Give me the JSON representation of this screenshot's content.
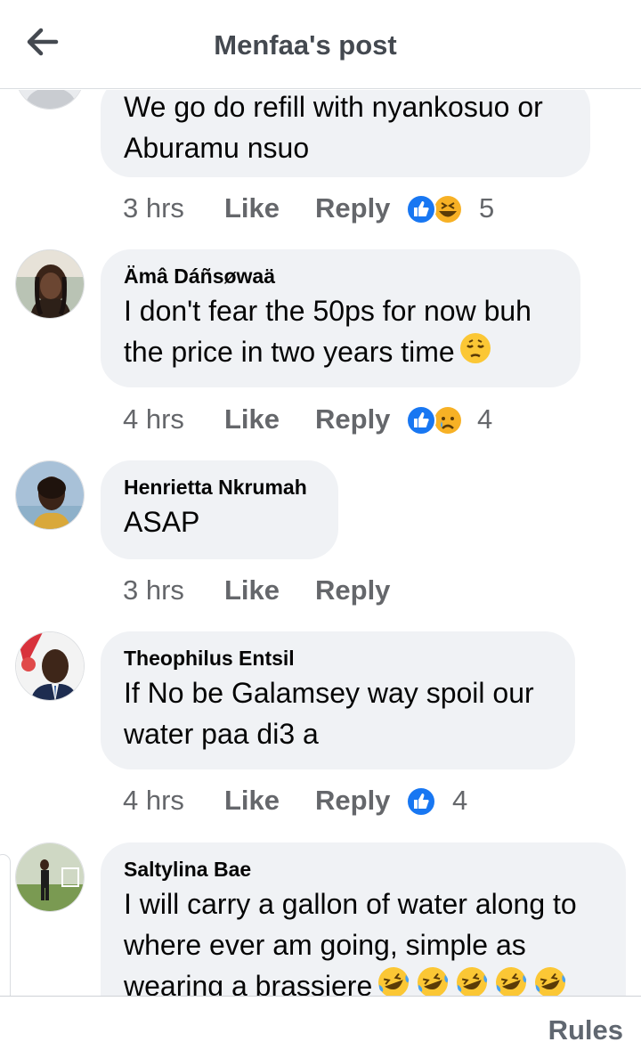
{
  "header": {
    "title": "Menfaa's post",
    "back_icon": "back-arrow-icon"
  },
  "comments": [
    {
      "name": "",
      "lines": [
        "We go do refill with nyankosuo or",
        "Aburamu nsuo"
      ],
      "time": "3 hrs",
      "like": "Like",
      "reply": "Reply",
      "reactions": [
        "like-icon",
        "haha-icon"
      ],
      "reaction_count": "5"
    },
    {
      "name": "Ämâ Dáñsøwaä",
      "lines": [
        "I don't fear the 50ps for now buh",
        "the price in two years time"
      ],
      "time": "4 hrs",
      "like": "Like",
      "reply": "Reply",
      "reactions": [
        "like-icon",
        "sad-icon"
      ],
      "reaction_count": "4"
    },
    {
      "name": "Henrietta Nkrumah",
      "lines": [
        "ASAP"
      ],
      "time": "3 hrs",
      "like": "Like",
      "reply": "Reply",
      "reactions": [],
      "reaction_count": ""
    },
    {
      "name": "Theophilus Entsil",
      "lines": [
        "If No be Galamsey way spoil our",
        "water paa di3 a"
      ],
      "time": "4 hrs",
      "like": "Like",
      "reply": "Reply",
      "reactions": [
        "like-icon"
      ],
      "reaction_count": "4"
    },
    {
      "name": "Saltylina Bae",
      "lines": [
        "I will carry a gallon of water along to",
        "where ever am going, simple as",
        "wearing a brassiere"
      ],
      "time": "",
      "like": "",
      "reply": "",
      "reactions": [],
      "reaction_count": ""
    }
  ],
  "footer": {
    "rules": "Rules"
  },
  "colors": {
    "like_blue": "#1877f2",
    "bubble_bg": "#f0f2f5",
    "meta_gray": "#65676b"
  }
}
